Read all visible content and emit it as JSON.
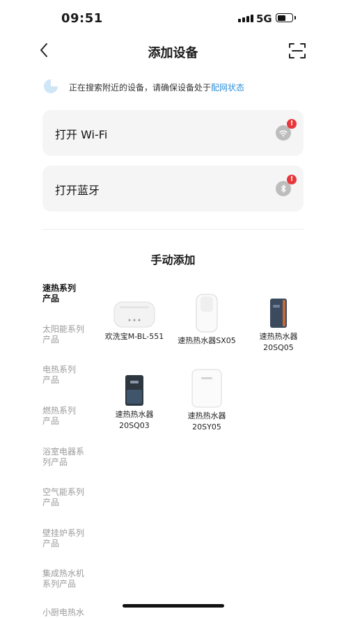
{
  "status_bar": {
    "time": "09:51",
    "network": "5G"
  },
  "header": {
    "title": "添加设备",
    "back_icon": "chevron-left-icon",
    "scan_icon": "scan-icon"
  },
  "search_hint": {
    "text": "正在搜索附近的设备，请确保设备处于",
    "link": "配网状态"
  },
  "cards": [
    {
      "label": "打开 Wi-Fi",
      "icon": "wifi-icon",
      "badge": "!"
    },
    {
      "label": "打开蓝牙",
      "icon": "bluetooth-icon",
      "badge": "!"
    }
  ],
  "manual_section": {
    "title": "手动添加"
  },
  "categories": [
    {
      "label": "速热系列产品",
      "line1": "速热系列",
      "line2": "产品",
      "active": true
    },
    {
      "label": "太阳能系列产品",
      "line1": "太阳能系列",
      "line2": "产品",
      "active": false
    },
    {
      "label": "电热系列产品",
      "line1": "电热系列",
      "line2": "产品",
      "active": false
    },
    {
      "label": "燃热系列产品",
      "line1": "燃热系列",
      "line2": "产品",
      "active": false
    },
    {
      "label": "浴室电器系列产品",
      "line1": "浴室电器系",
      "line2": "列产品",
      "active": false
    },
    {
      "label": "空气能系列产品",
      "line1": "空气能系列",
      "line2": "产品",
      "active": false
    },
    {
      "label": "壁挂炉系列产品",
      "line1": "壁挂炉系列",
      "line2": "产品",
      "active": false
    },
    {
      "label": "集成热水机系列产品",
      "line1": "集成热水机",
      "line2": "系列产品",
      "active": false
    },
    {
      "label": "小厨电热水",
      "line1": "小厨电热水",
      "line2": "",
      "active": false
    }
  ],
  "products": [
    {
      "line1": "欢洗宝M-BL-551",
      "line2": ""
    },
    {
      "line1": "速热热水器SX05",
      "line2": ""
    },
    {
      "line1": "速热热水器",
      "line2": "20SQ05"
    },
    {
      "line1": "速热热水器",
      "line2": "20SQ03"
    },
    {
      "line1": "速热热水器",
      "line2": "20SY05"
    }
  ],
  "colors": {
    "link": "#2f8fd8",
    "badge": "#e8363a",
    "card_bg": "#f5f5f5"
  }
}
